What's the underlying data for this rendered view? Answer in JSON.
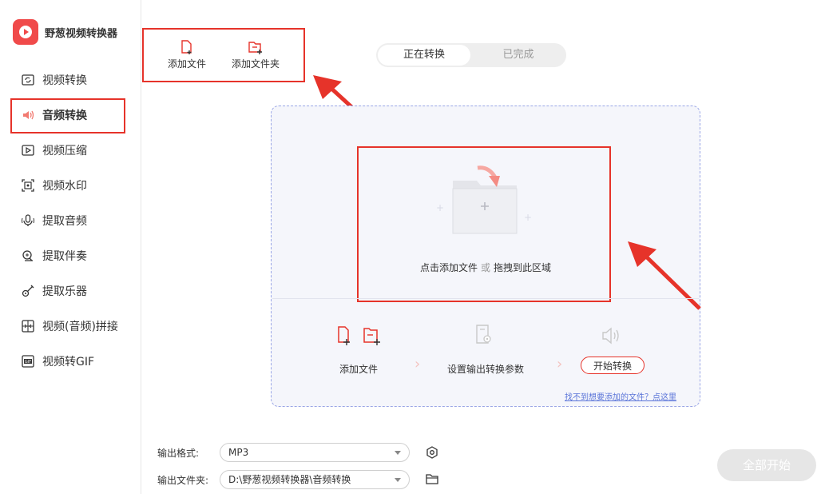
{
  "app": {
    "title": "野葱视频转换器"
  },
  "sidebar": {
    "items": [
      {
        "label": "视频转换",
        "icon": "video-convert-icon"
      },
      {
        "label": "音频转换",
        "icon": "audio-convert-icon",
        "active": true
      },
      {
        "label": "视频压缩",
        "icon": "video-compress-icon"
      },
      {
        "label": "视频水印",
        "icon": "video-watermark-icon"
      },
      {
        "label": "提取音频",
        "icon": "extract-audio-icon"
      },
      {
        "label": "提取伴奏",
        "icon": "extract-accompaniment-icon"
      },
      {
        "label": "提取乐器",
        "icon": "extract-instrument-icon"
      },
      {
        "label": "视频(音频)拼接",
        "icon": "merge-icon"
      },
      {
        "label": "视频转GIF",
        "icon": "gif-icon"
      }
    ]
  },
  "toolbar": {
    "add_file": "添加文件",
    "add_folder": "添加文件夹"
  },
  "tabs": {
    "converting": "正在转换",
    "done": "已完成"
  },
  "dropzone": {
    "text_a": "点击添加文件",
    "text_or": "或",
    "text_b": "拖拽到此区域"
  },
  "steps": {
    "add_file": "添加文件",
    "set_params": "设置输出转换参数",
    "start": "开始转换",
    "help_link": "找不到想要添加的文件？点这里"
  },
  "output": {
    "format_label": "输出格式:",
    "format_value": "MP3",
    "folder_label": "输出文件夹:",
    "folder_value": "D:\\野葱视频转换器\\音频转换"
  },
  "start_all": "全部开始",
  "colors": {
    "accent": "#e6332a",
    "dashed_border": "#9aa6e6",
    "link": "#5a74d8"
  }
}
